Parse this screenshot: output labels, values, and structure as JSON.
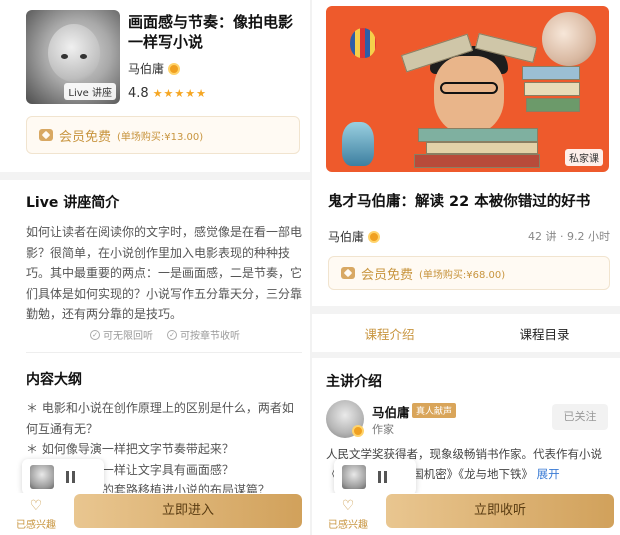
{
  "left": {
    "course": {
      "title": "画面感与节奏：像拍电影一样写小说",
      "cover_badge": "Live 讲座",
      "author": "马伯庸",
      "rating": "4.8",
      "stars": "★★★★★"
    },
    "membership": {
      "free_label": "会员免费",
      "price_label": "(单场购买:¥13.00)"
    },
    "intro": {
      "heading": "Live 讲座简介",
      "text": "如何让读者在阅读你的文字时，感觉像是在看一部电影？很简单，在小说创作里加入电影表现的种种技巧。其中最重要的两点：一是画面感，二是节奏，它们具体是如何实现的？小说写作五分靠天分，三分靠勤勉，还有两分靠的是技巧。",
      "tags": [
        "可无限回听",
        "可按章节收听"
      ]
    },
    "outline": {
      "heading": "内容大纲",
      "items": [
        "＊ 电影和小说在创作原理上的区别是什么，两者如何互通有无？",
        "＊ 如何像导演一样把文字节奏带起来？",
        "＊ 如何像镜头一样让文字具有画面感？",
        "＊ 如何将电影的套路移植进小说的布局谋篇？"
      ]
    },
    "bottom": {
      "like_label": "已感兴趣",
      "cta_label": "立即进入"
    }
  },
  "right": {
    "banner": {
      "badge": "私家课"
    },
    "course": {
      "title": "鬼才马伯庸：解读 22 本被你错过的好书",
      "author": "马伯庸",
      "meta": "42 讲 · 9.2 小时"
    },
    "membership": {
      "free_label": "会员免费",
      "price_label": "(单场购买:¥68.00)"
    },
    "tabs": [
      {
        "label": "课程介绍",
        "active": true
      },
      {
        "label": "课程目录",
        "active": false
      }
    ],
    "speaker": {
      "heading": "主讲介绍",
      "name": "马伯庸",
      "tag": "真人献声",
      "role": "作家",
      "follow_label": "已关注",
      "bio": "人民文学奖获得者，现象级畅销书作家。代表作有小说《风起陇西》《三国机密》《龙与地下铁》",
      "bio_more": "展开"
    },
    "bottom": {
      "like_label": "已感兴趣",
      "cta_label": "立即收听"
    }
  },
  "colors": {
    "gold": "#c8953f",
    "gold_btn_start": "#e9c690",
    "gold_btn_end": "#d1a15b",
    "banner": "#ee5a2c"
  }
}
